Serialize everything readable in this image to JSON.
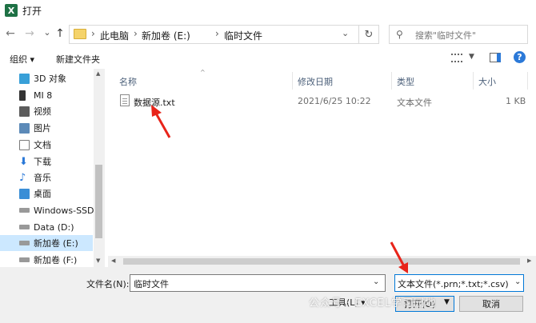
{
  "window": {
    "title": "打开",
    "app_icon_letter": "X"
  },
  "nav": {
    "back": "←",
    "forward": "→",
    "recent": "⌄",
    "up": "↑",
    "breadcrumb": [
      "此电脑",
      "新加卷 (E:)",
      "临时文件"
    ],
    "separator": "›",
    "refresh": "↻",
    "search_placeholder": "搜索\"临时文件\""
  },
  "toolbar": {
    "organize": "组织 ▾",
    "new_folder": "新建文件夹"
  },
  "sidebar": {
    "items": [
      {
        "label": "3D 对象",
        "icon": "3d-objects-icon",
        "color": "#39a0d8"
      },
      {
        "label": "MI 8",
        "icon": "phone-icon",
        "color": "#333333"
      },
      {
        "label": "视频",
        "icon": "video-icon",
        "color": "#5c5c5c"
      },
      {
        "label": "图片",
        "icon": "pictures-icon",
        "color": "#5c8ab8"
      },
      {
        "label": "文档",
        "icon": "documents-icon",
        "color": "#7a7a7a"
      },
      {
        "label": "下载",
        "icon": "download-icon",
        "color": "#2b79d8"
      },
      {
        "label": "音乐",
        "icon": "music-icon",
        "color": "#2b79d8"
      },
      {
        "label": "桌面",
        "icon": "desktop-icon",
        "color": "#3a8ed6"
      },
      {
        "label": "Windows-SSD",
        "icon": "drive-icon",
        "color": "#8a8a8a"
      },
      {
        "label": "Data (D:)",
        "icon": "drive-icon",
        "color": "#8a8a8a"
      },
      {
        "label": "新加卷 (E:)",
        "icon": "drive-icon",
        "color": "#8a8a8a"
      },
      {
        "label": "新加卷 (F:)",
        "icon": "drive-icon",
        "color": "#8a8a8a"
      }
    ],
    "selected_index": 10
  },
  "columns": {
    "name": "名称",
    "modified": "修改日期",
    "type": "类型",
    "size": "大小"
  },
  "files": [
    {
      "name": "数据源.txt",
      "modified": "2021/6/25 10:22",
      "type": "文本文件",
      "size": "1 KB"
    }
  ],
  "bottom": {
    "filename_label": "文件名(N):",
    "filename_value": "临时文件",
    "filetype_value": "文本文件(*.prn;*.txt;*.csv)",
    "tools_label": "工具(L)",
    "open_label": "打开(O)",
    "cancel_label": "取消"
  },
  "watermark": "公众号 · EXCEL学习园地",
  "colors": {
    "arrow": "#e8241a",
    "selection": "#cce8ff",
    "accent": "#0078d7"
  }
}
